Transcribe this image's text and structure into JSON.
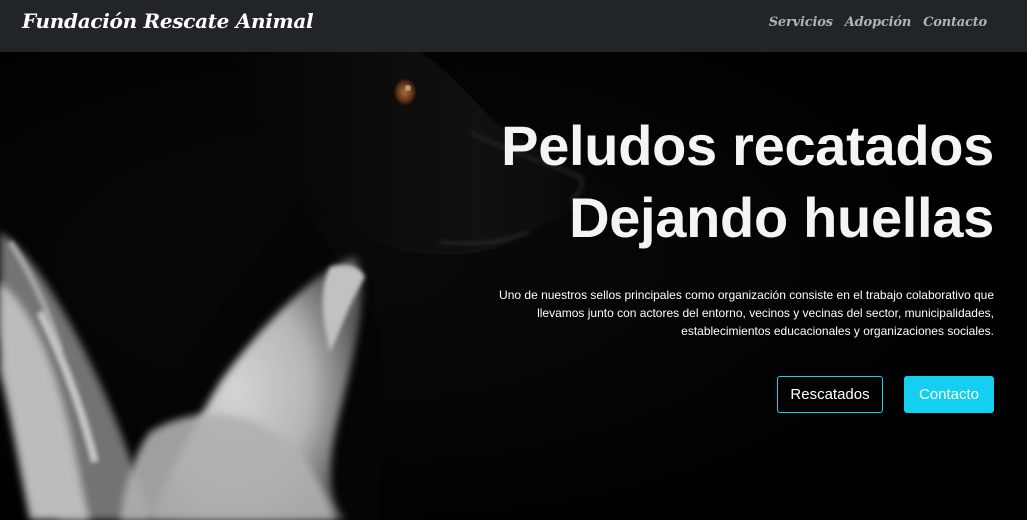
{
  "navbar": {
    "brand": "Fundación Rescate Animal",
    "links": [
      "Servicios",
      "Adopción",
      "Contacto"
    ]
  },
  "hero": {
    "title_line1": "Peludos recatados",
    "title_line2": "Dejando huellas",
    "description": "Uno de nuestros sellos principales como organización consiste en el trabajo colaborativo que llevamos junto con actores del entorno, vecinos y vecinas del sector, municipalidades, establecimientos educacionales y organizaciones sociales.",
    "buttons": {
      "rescued": "Rescatados",
      "contact": "Contacto"
    }
  },
  "colors": {
    "navbar_bg": "#212529",
    "accent": "#13cff0",
    "nav_link": "#aeb3b8"
  }
}
